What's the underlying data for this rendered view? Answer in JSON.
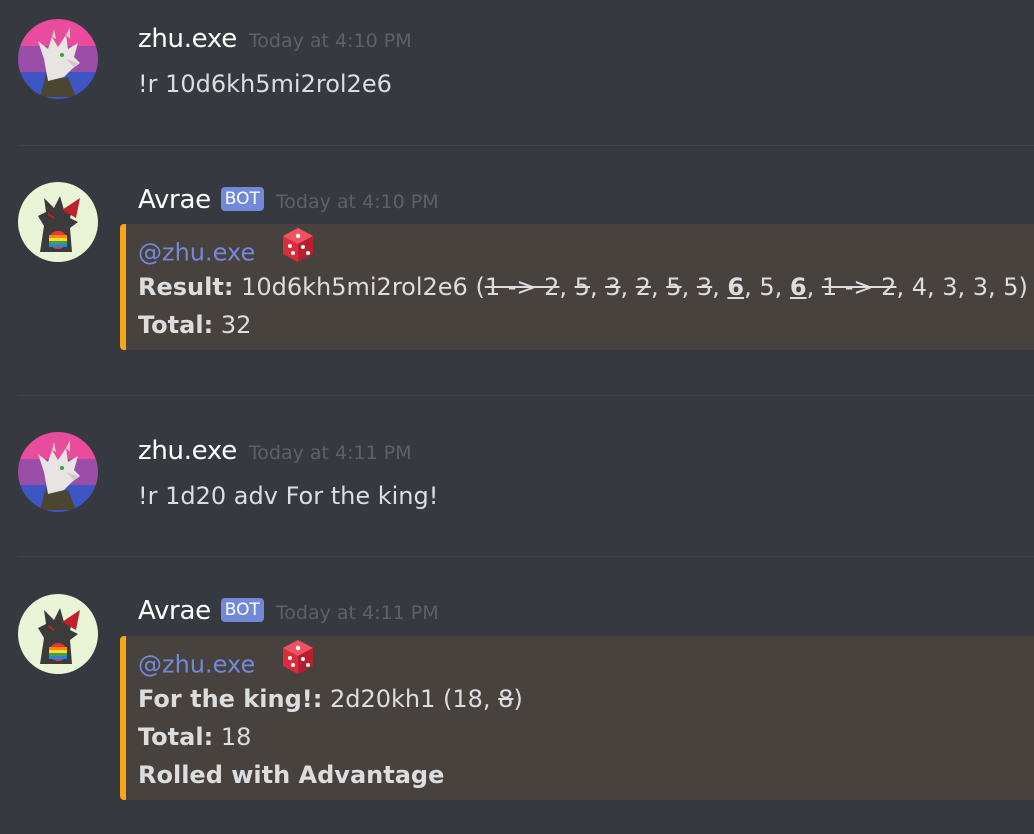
{
  "messages": [
    {
      "username": "zhu.exe",
      "timestamp": "Today at 4:10 PM",
      "text": "!r 10d6kh5mi2rol2e6"
    },
    {
      "username": "Avrae",
      "bot_tag": "BOT",
      "timestamp": "Today at 4:10 PM",
      "embed": {
        "mention": "@zhu.exe",
        "result_label": "Result:",
        "result_expr": "10d6kh5mi2rol2e6 (",
        "dice": [
          {
            "text": "1 -> 2",
            "style": "strike"
          },
          {
            "text": ", ",
            "style": "plain"
          },
          {
            "text": "5",
            "style": "strike"
          },
          {
            "text": ", ",
            "style": "plain"
          },
          {
            "text": "3",
            "style": "strike"
          },
          {
            "text": ", ",
            "style": "plain"
          },
          {
            "text": "2",
            "style": "strike"
          },
          {
            "text": ", ",
            "style": "plain"
          },
          {
            "text": "5",
            "style": "strike"
          },
          {
            "text": ", ",
            "style": "plain"
          },
          {
            "text": "3",
            "style": "strike"
          },
          {
            "text": ", ",
            "style": "plain"
          },
          {
            "text": "6",
            "style": "under"
          },
          {
            "text": ", 5, ",
            "style": "plain"
          },
          {
            "text": "6",
            "style": "under"
          },
          {
            "text": ", ",
            "style": "plain"
          },
          {
            "text": "1 -> 2",
            "style": "strike"
          },
          {
            "text": ", 4, 3, 3, 5)",
            "style": "plain"
          }
        ],
        "total_label": "Total:",
        "total_value": "32"
      }
    },
    {
      "username": "zhu.exe",
      "timestamp": "Today at 4:11 PM",
      "text": "!r 1d20 adv For the king!"
    },
    {
      "username": "Avrae",
      "bot_tag": "BOT",
      "timestamp": "Today at 4:11 PM",
      "embed": {
        "mention": "@zhu.exe",
        "result_label": "For the king!:",
        "result_expr": "2d20kh1 (18, ",
        "struck": "8",
        "result_close": ")",
        "total_label": "Total:",
        "total_value": "18",
        "footer": "Rolled with Advantage"
      }
    }
  ],
  "colors": {
    "background": "#36393f",
    "embed_bg": "#48423f",
    "embed_border": "#faa61a",
    "mention": "#7289da",
    "bot_tag": "#7289da",
    "timestamp": "#5c6168"
  },
  "icons": [
    "dragon-avatar-icon",
    "black-dragon-avatar-icon",
    "dice-icon"
  ]
}
